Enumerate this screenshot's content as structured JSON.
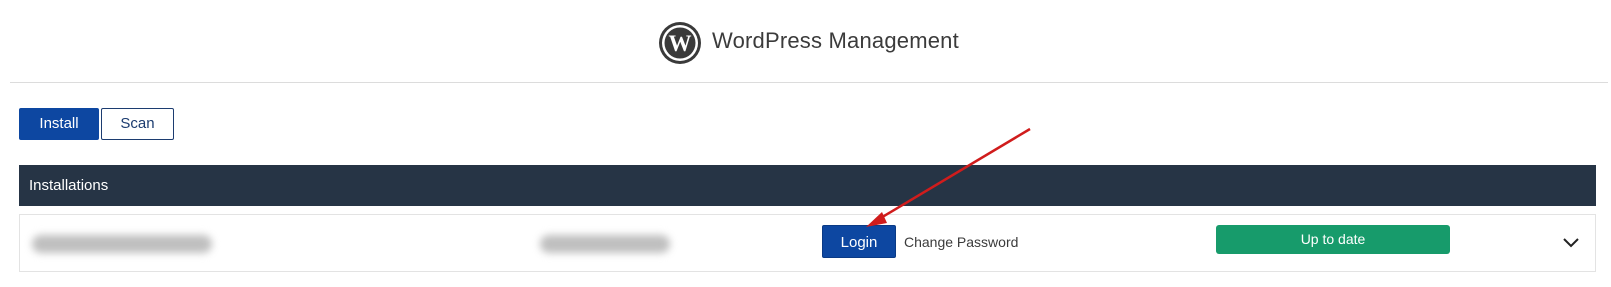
{
  "header": {
    "title": "WordPress Management",
    "logo_icon": "wordpress-logo-icon"
  },
  "actions": {
    "install_label": "Install",
    "scan_label": "Scan"
  },
  "installations": {
    "title": "Installations",
    "rows": [
      {
        "domain": "",
        "path": "",
        "login_label": "Login",
        "change_password_label": "Change Password",
        "status": "Up to date",
        "expand_icon": "chevron-down-icon"
      }
    ]
  },
  "annotation": {
    "arrow_icon": "red-arrow-icon",
    "color": "#d01c1c"
  },
  "colors": {
    "primary": "#0d47a1",
    "header_bg": "#263445",
    "status_green": "#179b6b"
  }
}
